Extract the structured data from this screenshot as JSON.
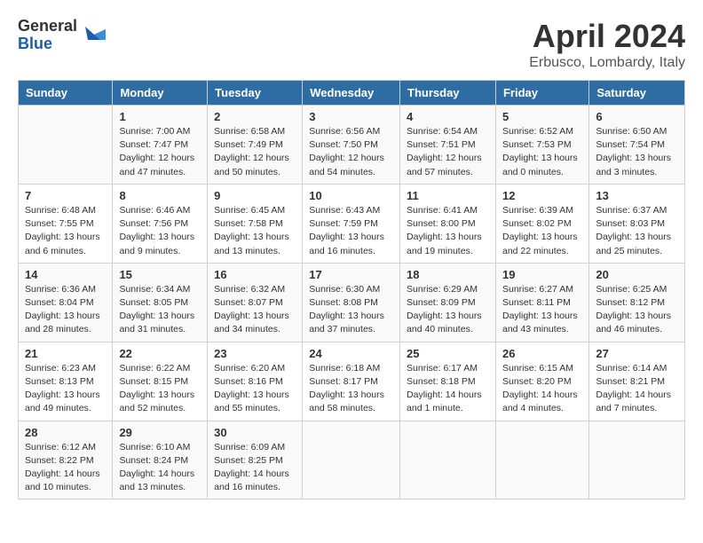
{
  "header": {
    "logo_general": "General",
    "logo_blue": "Blue",
    "title": "April 2024",
    "location": "Erbusco, Lombardy, Italy"
  },
  "columns": [
    "Sunday",
    "Monday",
    "Tuesday",
    "Wednesday",
    "Thursday",
    "Friday",
    "Saturday"
  ],
  "weeks": [
    [
      {
        "day": "",
        "sunrise": "",
        "sunset": "",
        "daylight": ""
      },
      {
        "day": "1",
        "sunrise": "7:00 AM",
        "sunset": "7:47 PM",
        "daylight": "12 hours and 47 minutes."
      },
      {
        "day": "2",
        "sunrise": "6:58 AM",
        "sunset": "7:49 PM",
        "daylight": "12 hours and 50 minutes."
      },
      {
        "day": "3",
        "sunrise": "6:56 AM",
        "sunset": "7:50 PM",
        "daylight": "12 hours and 54 minutes."
      },
      {
        "day": "4",
        "sunrise": "6:54 AM",
        "sunset": "7:51 PM",
        "daylight": "12 hours and 57 minutes."
      },
      {
        "day": "5",
        "sunrise": "6:52 AM",
        "sunset": "7:53 PM",
        "daylight": "13 hours and 0 minutes."
      },
      {
        "day": "6",
        "sunrise": "6:50 AM",
        "sunset": "7:54 PM",
        "daylight": "13 hours and 3 minutes."
      }
    ],
    [
      {
        "day": "7",
        "sunrise": "6:48 AM",
        "sunset": "7:55 PM",
        "daylight": "13 hours and 6 minutes."
      },
      {
        "day": "8",
        "sunrise": "6:46 AM",
        "sunset": "7:56 PM",
        "daylight": "13 hours and 9 minutes."
      },
      {
        "day": "9",
        "sunrise": "6:45 AM",
        "sunset": "7:58 PM",
        "daylight": "13 hours and 13 minutes."
      },
      {
        "day": "10",
        "sunrise": "6:43 AM",
        "sunset": "7:59 PM",
        "daylight": "13 hours and 16 minutes."
      },
      {
        "day": "11",
        "sunrise": "6:41 AM",
        "sunset": "8:00 PM",
        "daylight": "13 hours and 19 minutes."
      },
      {
        "day": "12",
        "sunrise": "6:39 AM",
        "sunset": "8:02 PM",
        "daylight": "13 hours and 22 minutes."
      },
      {
        "day": "13",
        "sunrise": "6:37 AM",
        "sunset": "8:03 PM",
        "daylight": "13 hours and 25 minutes."
      }
    ],
    [
      {
        "day": "14",
        "sunrise": "6:36 AM",
        "sunset": "8:04 PM",
        "daylight": "13 hours and 28 minutes."
      },
      {
        "day": "15",
        "sunrise": "6:34 AM",
        "sunset": "8:05 PM",
        "daylight": "13 hours and 31 minutes."
      },
      {
        "day": "16",
        "sunrise": "6:32 AM",
        "sunset": "8:07 PM",
        "daylight": "13 hours and 34 minutes."
      },
      {
        "day": "17",
        "sunrise": "6:30 AM",
        "sunset": "8:08 PM",
        "daylight": "13 hours and 37 minutes."
      },
      {
        "day": "18",
        "sunrise": "6:29 AM",
        "sunset": "8:09 PM",
        "daylight": "13 hours and 40 minutes."
      },
      {
        "day": "19",
        "sunrise": "6:27 AM",
        "sunset": "8:11 PM",
        "daylight": "13 hours and 43 minutes."
      },
      {
        "day": "20",
        "sunrise": "6:25 AM",
        "sunset": "8:12 PM",
        "daylight": "13 hours and 46 minutes."
      }
    ],
    [
      {
        "day": "21",
        "sunrise": "6:23 AM",
        "sunset": "8:13 PM",
        "daylight": "13 hours and 49 minutes."
      },
      {
        "day": "22",
        "sunrise": "6:22 AM",
        "sunset": "8:15 PM",
        "daylight": "13 hours and 52 minutes."
      },
      {
        "day": "23",
        "sunrise": "6:20 AM",
        "sunset": "8:16 PM",
        "daylight": "13 hours and 55 minutes."
      },
      {
        "day": "24",
        "sunrise": "6:18 AM",
        "sunset": "8:17 PM",
        "daylight": "13 hours and 58 minutes."
      },
      {
        "day": "25",
        "sunrise": "6:17 AM",
        "sunset": "8:18 PM",
        "daylight": "14 hours and 1 minute."
      },
      {
        "day": "26",
        "sunrise": "6:15 AM",
        "sunset": "8:20 PM",
        "daylight": "14 hours and 4 minutes."
      },
      {
        "day": "27",
        "sunrise": "6:14 AM",
        "sunset": "8:21 PM",
        "daylight": "14 hours and 7 minutes."
      }
    ],
    [
      {
        "day": "28",
        "sunrise": "6:12 AM",
        "sunset": "8:22 PM",
        "daylight": "14 hours and 10 minutes."
      },
      {
        "day": "29",
        "sunrise": "6:10 AM",
        "sunset": "8:24 PM",
        "daylight": "14 hours and 13 minutes."
      },
      {
        "day": "30",
        "sunrise": "6:09 AM",
        "sunset": "8:25 PM",
        "daylight": "14 hours and 16 minutes."
      },
      {
        "day": "",
        "sunrise": "",
        "sunset": "",
        "daylight": ""
      },
      {
        "day": "",
        "sunrise": "",
        "sunset": "",
        "daylight": ""
      },
      {
        "day": "",
        "sunrise": "",
        "sunset": "",
        "daylight": ""
      },
      {
        "day": "",
        "sunrise": "",
        "sunset": "",
        "daylight": ""
      }
    ]
  ],
  "labels": {
    "sunrise_prefix": "Sunrise: ",
    "sunset_prefix": "Sunset: ",
    "daylight_prefix": "Daylight: "
  }
}
